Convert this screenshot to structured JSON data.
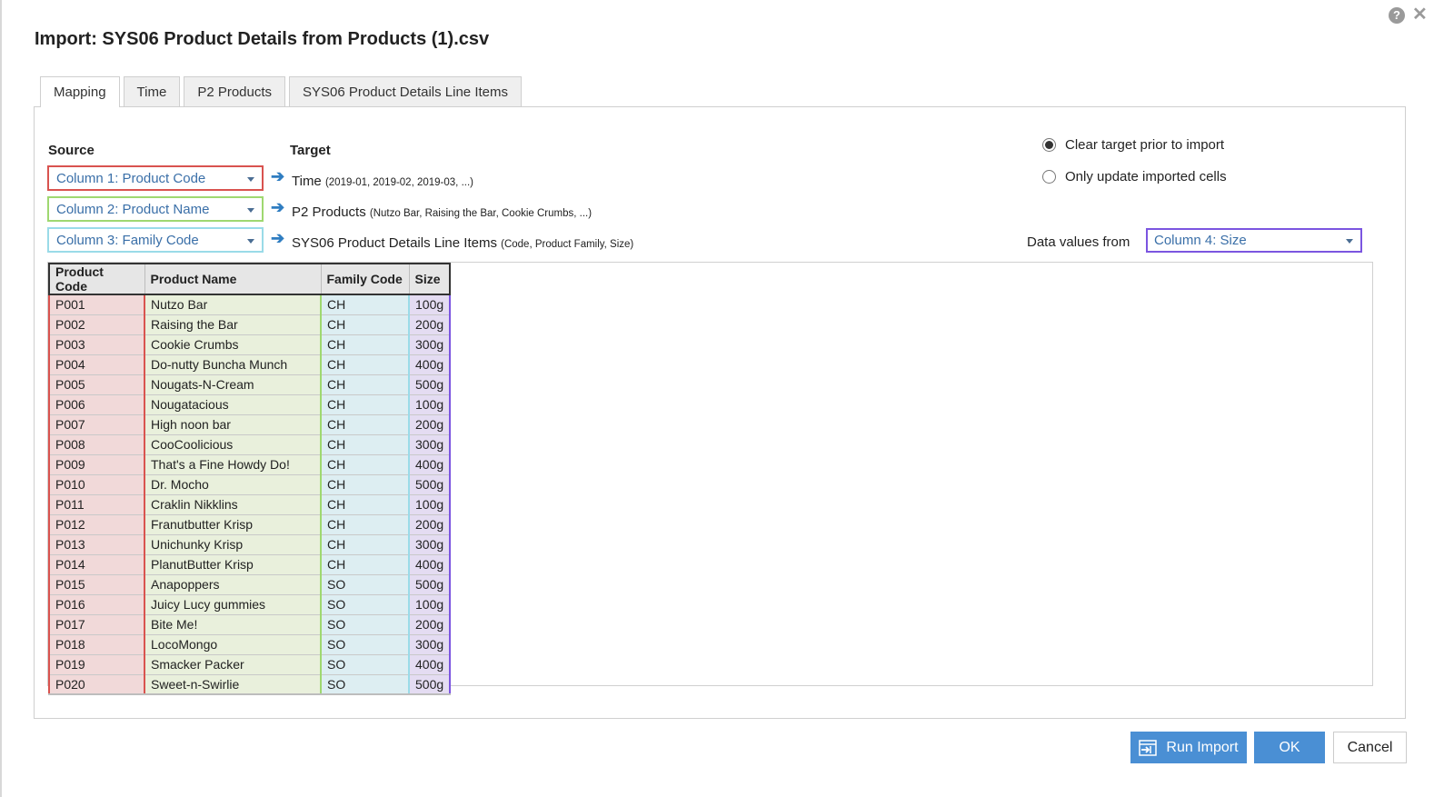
{
  "dialog": {
    "title": "Import: SYS06 Product Details from Products (1).csv",
    "help_icon": "question-circle-icon",
    "close_icon": "close-x-icon"
  },
  "tabs": [
    {
      "label": "Mapping",
      "active": true
    },
    {
      "label": "Time",
      "active": false
    },
    {
      "label": "P2 Products",
      "active": false
    },
    {
      "label": "SYS06 Product Details Line Items",
      "active": false
    }
  ],
  "mapping": {
    "source_label": "Source",
    "target_label": "Target",
    "rows": [
      {
        "source": "Column 1: Product Code",
        "target": "Time",
        "hint": "(2019-01, 2019-02, 2019-03, ...)",
        "color": "#d9534f"
      },
      {
        "source": "Column 2: Product Name",
        "target": "P2 Products",
        "hint": "(Nutzo Bar, Raising the Bar, Cookie Crumbs, ...)",
        "color": "#9fd870"
      },
      {
        "source": "Column 3: Family Code",
        "target": "SYS06 Product Details Line Items",
        "hint": "(Code, Product Family, Size)",
        "color": "#9adbe8"
      }
    ],
    "arrow_icon": "arrow-right-icon"
  },
  "options": {
    "clear_target": {
      "label": "Clear target prior to import",
      "checked": true
    },
    "only_update": {
      "label": "Only update imported cells",
      "checked": false
    }
  },
  "data_values": {
    "label": "Data values from",
    "selected": "Column 4: Size",
    "color": "#7b55e0"
  },
  "preview": {
    "headers": [
      "Product Code",
      "Product Name",
      "Family Code",
      "Size"
    ],
    "rows": [
      [
        "P001",
        "Nutzo Bar",
        "CH",
        "100g"
      ],
      [
        "P002",
        "Raising the Bar",
        "CH",
        "200g"
      ],
      [
        "P003",
        "Cookie Crumbs",
        "CH",
        "300g"
      ],
      [
        "P004",
        "Do-nutty Buncha Munch",
        "CH",
        "400g"
      ],
      [
        "P005",
        "Nougats-N-Cream",
        "CH",
        "500g"
      ],
      [
        "P006",
        "Nougatacious",
        "CH",
        "100g"
      ],
      [
        "P007",
        "High noon bar",
        "CH",
        "200g"
      ],
      [
        "P008",
        "CooCoolicious",
        "CH",
        "300g"
      ],
      [
        "P009",
        "That's a Fine Howdy Do!",
        "CH",
        "400g"
      ],
      [
        "P010",
        "Dr. Mocho",
        "CH",
        "500g"
      ],
      [
        "P011",
        "Craklin Nikklins",
        "CH",
        "100g"
      ],
      [
        "P012",
        "Franutbutter Krisp",
        "CH",
        "200g"
      ],
      [
        "P013",
        "Unichunky Krisp",
        "CH",
        "300g"
      ],
      [
        "P014",
        "PlanutButter Krisp",
        "CH",
        "400g"
      ],
      [
        "P015",
        "Anapoppers",
        "SO",
        "500g"
      ],
      [
        "P016",
        "Juicy Lucy gummies",
        "SO",
        "100g"
      ],
      [
        "P017",
        "Bite Me!",
        "SO",
        "200g"
      ],
      [
        "P018",
        "LocoMongo",
        "SO",
        "300g"
      ],
      [
        "P019",
        "Smacker Packer",
        "SO",
        "400g"
      ],
      [
        "P020",
        "Sweet-n-Swirlie",
        "SO",
        "500g"
      ]
    ]
  },
  "footer": {
    "run_import_label": "Run Import",
    "run_import_icon": "import-icon",
    "ok_label": "OK",
    "cancel_label": "Cancel",
    "primary_color": "#4a8fd4"
  }
}
